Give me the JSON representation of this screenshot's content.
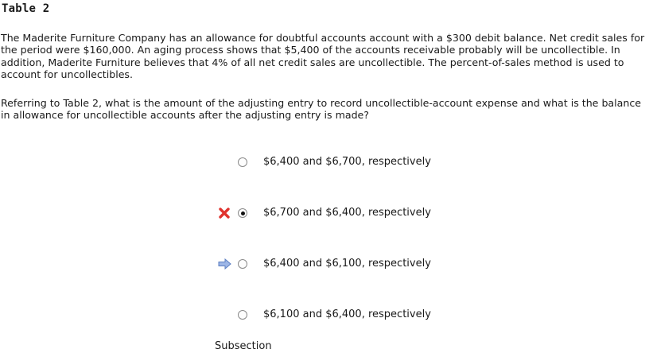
{
  "table_title": "Table 2",
  "context": "The Maderite Furniture Company has an allowance for doubtful accounts account with a $300 debit balance. Net credit sales for the period were $160,000. An aging process shows that $5,400 of the accounts receivable probably will be uncollectible. In addition, Maderite Furniture believes that 4% of all net credit sales are uncollectible. The percent-of-sales method is used to account for uncollectibles.",
  "question": "Referring to Table 2, what is the amount of the adjusting entry to record uncollectible-account expense and what is the balance in allowance for uncollectible accounts after the adjusting entry is made?",
  "options": [
    {
      "label": "$6,400 and $6,700, respectively",
      "selected": false,
      "marker": "none"
    },
    {
      "label": "$6,700 and $6,400, respectively",
      "selected": true,
      "marker": "incorrect-x-icon"
    },
    {
      "label": "$6,400 and $6,100, respectively",
      "selected": false,
      "marker": "correct-arrow-icon"
    },
    {
      "label": "$6,100 and $6,400, respectively",
      "selected": false,
      "marker": "none"
    }
  ],
  "footer_label": "Subsection",
  "colors": {
    "incorrect_marker": "#e0332e",
    "correct_marker": "#7f9fd8"
  }
}
